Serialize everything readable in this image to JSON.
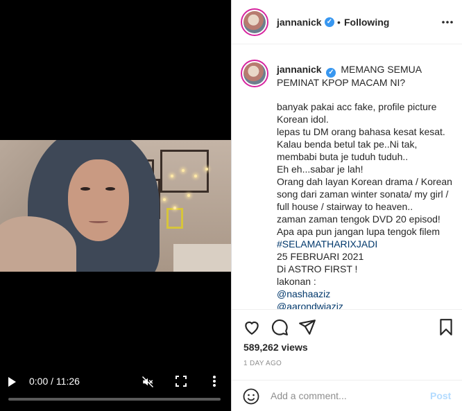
{
  "video": {
    "time": "0:00 / 11:26",
    "progress": 0,
    "play_icon": "play-icon",
    "mute_icon": "muted-icon",
    "fullscreen_icon": "fullscreen-icon",
    "menu_icon": "more-vertical-icon"
  },
  "header": {
    "username": "jannanick",
    "separator": "•",
    "follow_status": "Following",
    "menu_icon": "more-horizontal-icon"
  },
  "caption": {
    "username": "jannanick",
    "first_line": "MEMANG SEMUA PEMINAT KPOP MACAM NI?",
    "body": "banyak pakai acc fake, profile picture Korean idol.\nlepas tu DM orang bahasa kesat kesat. Kalau benda betul tak pe..Ni tak, membabi buta je tuduh tuduh..\nEh eh...sabar je lah!\nOrang dah layan Korean drama / Korean song dari zaman winter sonata/ my girl / full house / stairway to heaven..\nzaman zaman tengok DVD 20 episod!\nApa apa pun jangan lupa tengok filem",
    "hashtag": "#SELAMATHARIXJADI",
    "date": "25 FEBRUARI 2021",
    "channel": "Di ASTRO FIRST !",
    "cast_label": "lakonan :",
    "mention1": "@nashaaziz",
    "mention2": "@aarondwiaziz"
  },
  "actions": {
    "views": "589,262 views",
    "time_ago": "1 DAY AGO"
  },
  "comment": {
    "placeholder": "Add a comment...",
    "post_label": "Post"
  },
  "colors": {
    "verified": "#3897f0",
    "link": "#00376b",
    "post_disabled": "#b3dbff"
  }
}
